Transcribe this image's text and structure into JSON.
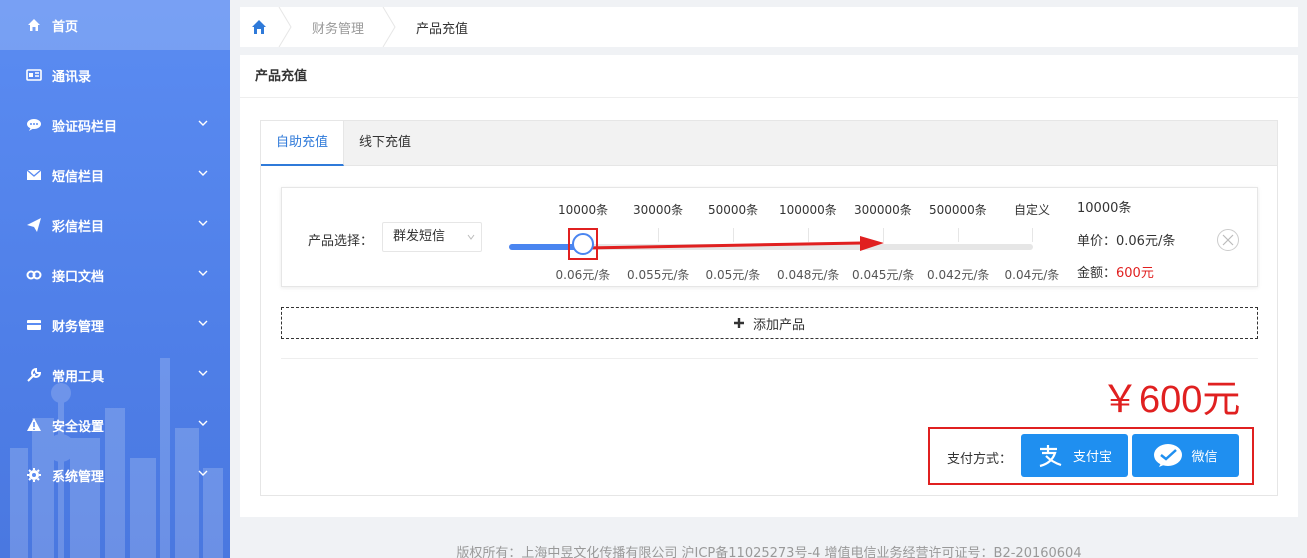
{
  "sidebar": {
    "items": [
      {
        "label": "首页",
        "icon": "home-icon",
        "active": true,
        "expandable": false
      },
      {
        "label": "通讯录",
        "icon": "contacts-icon",
        "active": false,
        "expandable": false
      },
      {
        "label": "验证码栏目",
        "icon": "chat-icon",
        "active": false,
        "expandable": true
      },
      {
        "label": "短信栏目",
        "icon": "mail-icon",
        "active": false,
        "expandable": true
      },
      {
        "label": "彩信栏目",
        "icon": "send-icon",
        "active": false,
        "expandable": true
      },
      {
        "label": "接口文档",
        "icon": "link-icon",
        "active": false,
        "expandable": true
      },
      {
        "label": "财务管理",
        "icon": "card-icon",
        "active": false,
        "expandable": true
      },
      {
        "label": "常用工具",
        "icon": "wrench-icon",
        "active": false,
        "expandable": true
      },
      {
        "label": "安全设置",
        "icon": "warning-icon",
        "active": false,
        "expandable": true
      },
      {
        "label": "系统管理",
        "icon": "gear-icon",
        "active": false,
        "expandable": true
      }
    ]
  },
  "breadcrumb": {
    "parent": "财务管理",
    "current": "产品充值"
  },
  "panel": {
    "title": "产品充值"
  },
  "tabs": [
    {
      "label": "自助充值",
      "active": true
    },
    {
      "label": "线下充值",
      "active": false
    }
  ],
  "product": {
    "select_label": "产品选择：",
    "selected": "群发短信",
    "slider": {
      "value_index": 0,
      "quantities": [
        "10000条",
        "30000条",
        "50000条",
        "100000条",
        "300000条",
        "500000条",
        "自定义"
      ],
      "prices": [
        "0.06元/条",
        "0.055元/条",
        "0.05元/条",
        "0.048元/条",
        "0.045元/条",
        "0.042元/条",
        "0.04元/条"
      ]
    },
    "info": {
      "quantity": "10000条",
      "unit_price": "单价：0.06元/条",
      "amount_label": "金额：",
      "amount_value": "600元"
    }
  },
  "add_product_label": "添加产品",
  "total": "￥600元",
  "payment": {
    "label": "支付方式：",
    "alipay": "支付宝",
    "wechat": "微信"
  },
  "footer": "版权所有：上海中昱文化传播有限公司 沪ICP备11025273号-4 增值电信业务经营许可证号：B2-20160604",
  "colors": {
    "sidebar": "#5b8cf2",
    "accent": "#2f7ad9",
    "highlight": "#e02020",
    "pay_button": "#1f8ff0"
  }
}
